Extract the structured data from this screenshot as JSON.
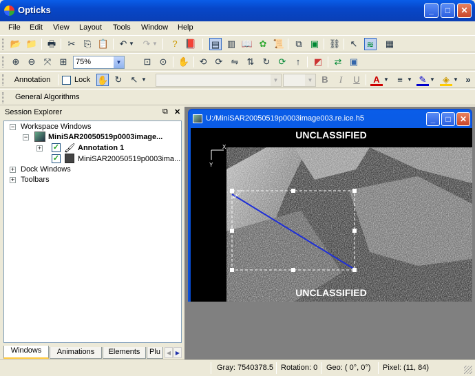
{
  "window": {
    "title": "Opticks",
    "min": "_",
    "max": "□",
    "close": "✕"
  },
  "menu": [
    "File",
    "Edit",
    "View",
    "Layout",
    "Tools",
    "Window",
    "Help"
  ],
  "toolbar": {
    "zoom": "75%",
    "annotation_label": "Annotation",
    "lock_label": "Lock",
    "bold": "B",
    "italic": "I",
    "underline": "U",
    "more": "»",
    "general_algorithms": "General Algorithms"
  },
  "session": {
    "title": "Session Explorer",
    "float": "⧉",
    "close": "✕",
    "tree": {
      "workspace": "Workspace Windows",
      "image_window": "MiniSAR20050519p0003image...",
      "annotation": "Annotation 1",
      "raster": "MiniSAR20050519p0003ima...",
      "dock": "Dock Windows",
      "toolbars": "Toolbars"
    },
    "tabs": [
      "Windows",
      "Animations",
      "Elements",
      "Plu"
    ]
  },
  "image_window": {
    "title": "U:/MiniSAR20050519p0003image003.re.ice.h5",
    "classification_top": "UNCLASSIFIED",
    "classification_bottom": "UNCLASSIFIED",
    "axis_x": "X",
    "axis_y": "Y"
  },
  "status": {
    "gray": "Gray: 7540378.5",
    "rotation": "Rotation: 0",
    "geo": "Geo: ( 0°,  0°)",
    "pixel": "Pixel: (11, 84)"
  }
}
